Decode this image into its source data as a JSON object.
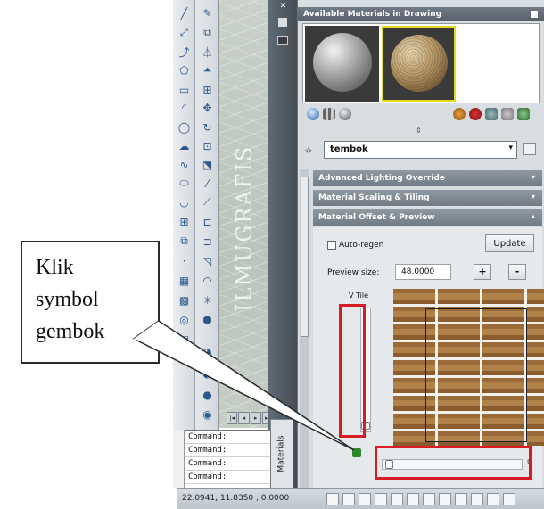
{
  "palette": {
    "available_header": "Available Materials in Drawing",
    "selected_material": "tembok",
    "sections": [
      {
        "label": "Advanced Lighting Override",
        "state": "collapsed"
      },
      {
        "label": "Material Scaling & Tiling",
        "state": "collapsed"
      },
      {
        "label": "Material Offset & Preview",
        "state": "expanded"
      }
    ],
    "auto_regen_label": "Auto-regen",
    "update_label": "Update",
    "preview_size_label": "Preview size:",
    "preview_size_value": "48.0000",
    "plus_label": "+",
    "minus_label": "-",
    "v_tile_label": "V Tile",
    "u_label": "U"
  },
  "side_tab": {
    "label": "Materials"
  },
  "watermark": "ILMUGRAFIS",
  "command_lines": [
    "Command:",
    "Command:",
    "Command:",
    "Command:"
  ],
  "status": {
    "coords": "22.0941, 11.8350 , 0.0000"
  },
  "callout": {
    "line1": "Klik",
    "line2": "symbol",
    "line3": "gembok"
  },
  "colors": {
    "highlight_red": "#d81b24",
    "selected_swatch_border": "#e8d81e"
  }
}
